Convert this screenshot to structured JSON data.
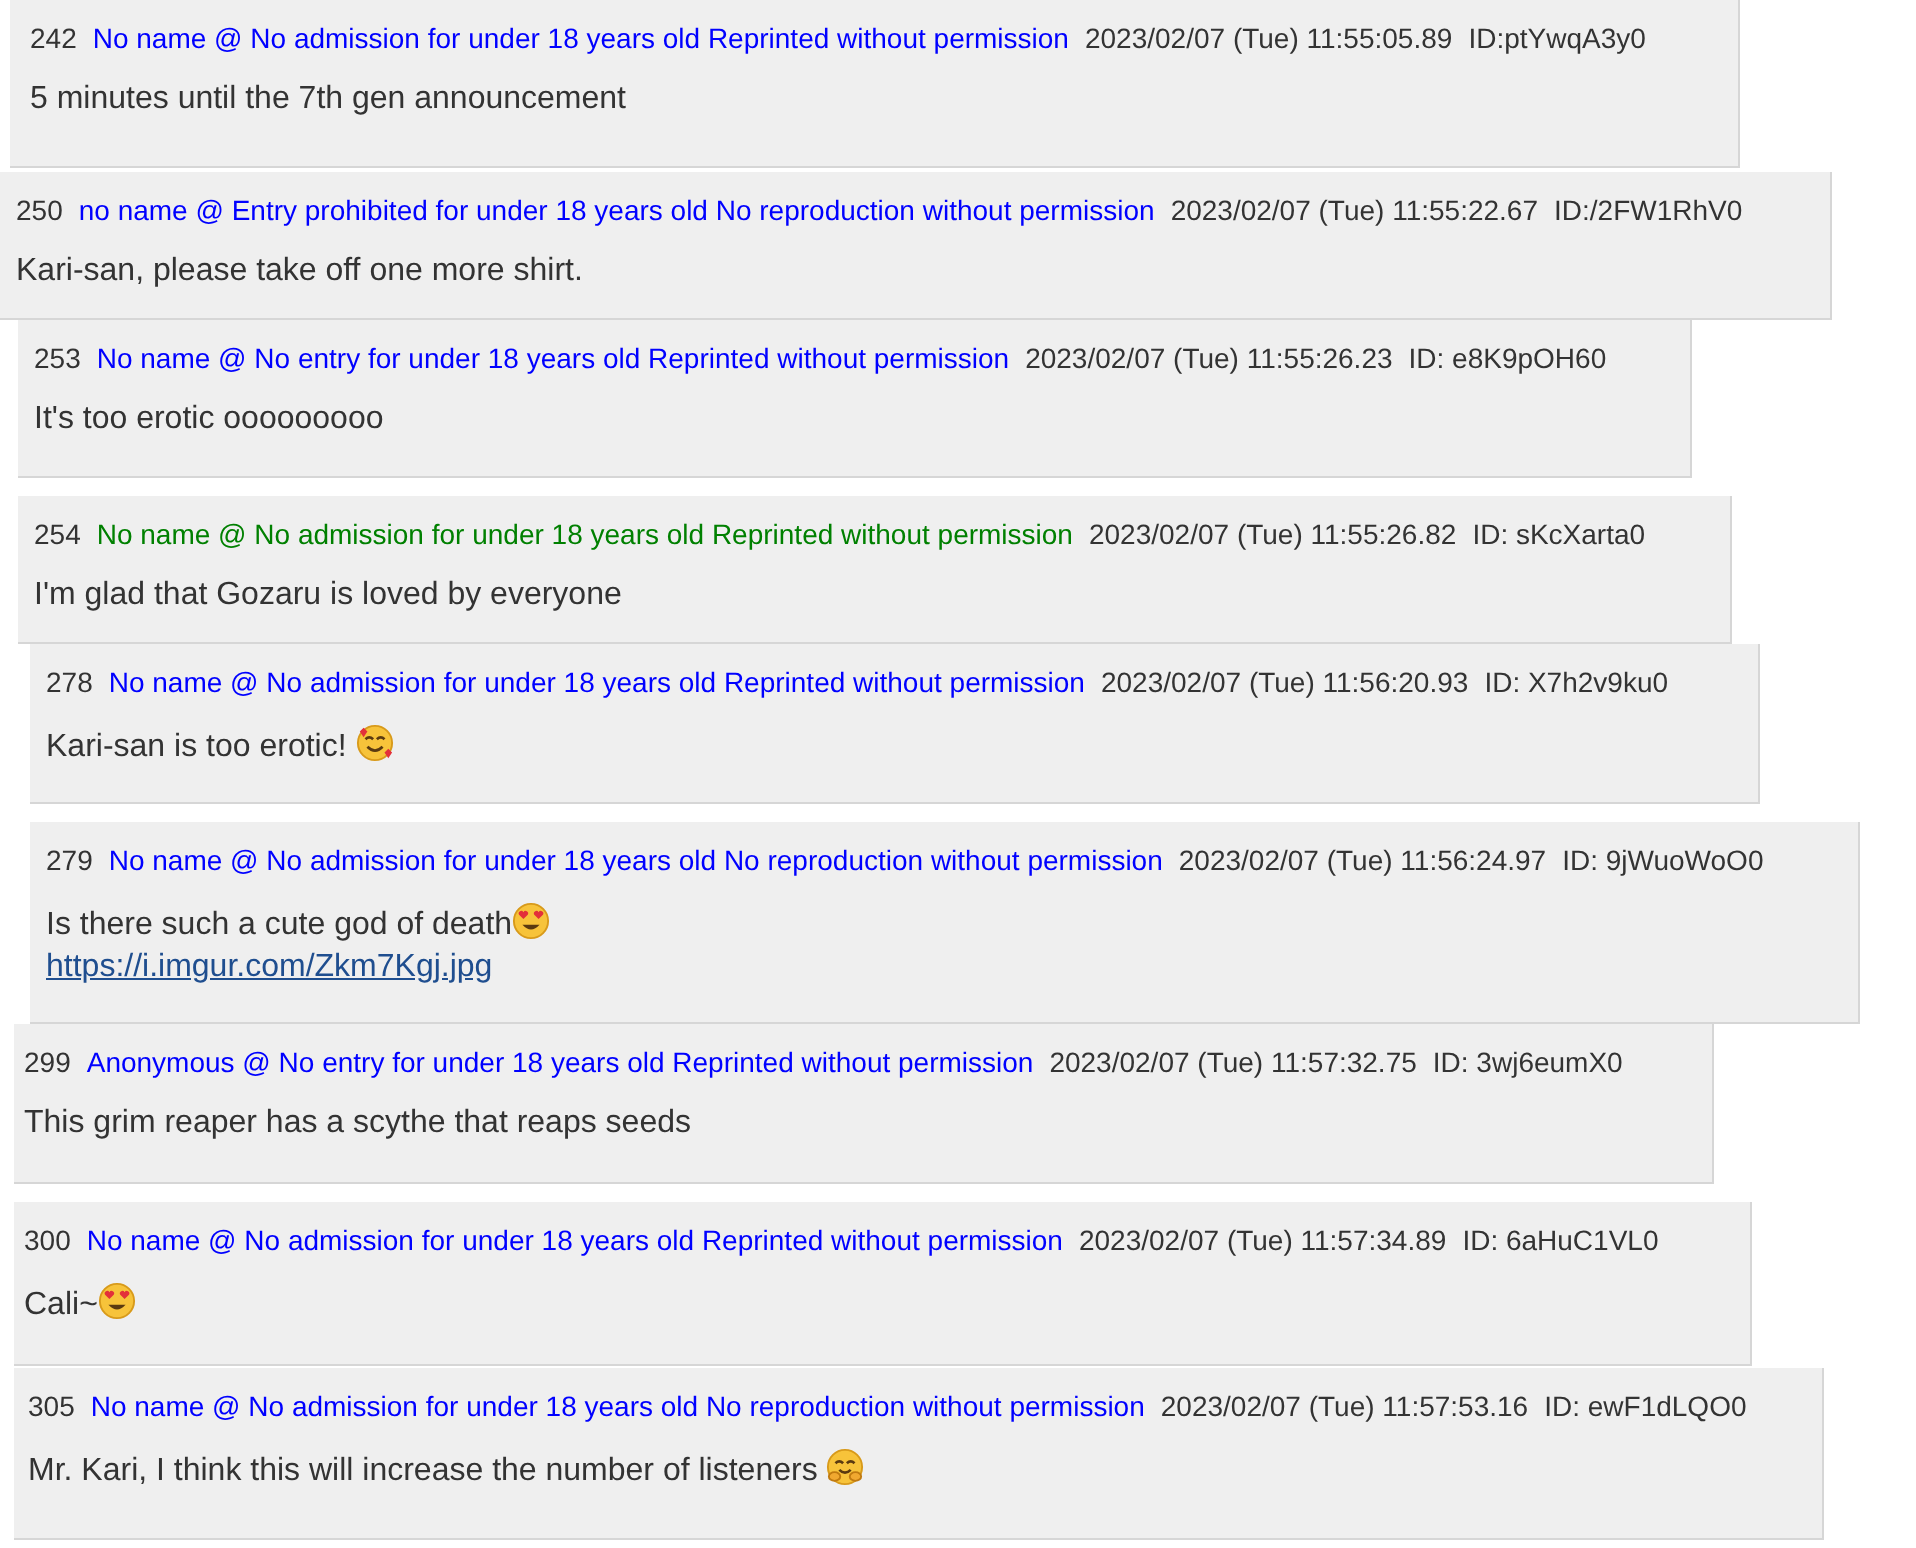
{
  "posts": [
    {
      "number": "242",
      "name": "No name @ No admission for under 18 years old Reprinted without permission",
      "color": "#0000ff",
      "date": "2023/02/07 (Tue) 11:55:05.89",
      "id": "ID:ptYwqA3y0",
      "message": "5 minutes until the 7th gen announcement"
    },
    {
      "number": "250",
      "name": "no name @ Entry prohibited for under 18 years old No reproduction without permission",
      "color": "#0000ff",
      "date": "2023/02/07 (Tue) 11:55:22.67",
      "id": "ID:/2FW1RhV0",
      "message": "Kari-san, please take off one more shirt."
    },
    {
      "number": "253",
      "name": "No name @ No entry for under 18 years old Reprinted without permission",
      "color": "#0000ff",
      "date": "2023/02/07 (Tue) 11:55:26.23",
      "id": "ID: e8K9pOH60",
      "message": "It's too erotic ooooooooo"
    },
    {
      "number": "254",
      "name": "No name @ No admission for under 18 years old Reprinted without permission",
      "color": "#008000",
      "date": "2023/02/07 (Tue) 11:55:26.82",
      "id": "ID: sKcXarta0",
      "message": "I'm glad that Gozaru is loved by everyone"
    },
    {
      "number": "278",
      "name": "No name @ No admission for under 18 years old Reprinted without permission",
      "color": "#0000ff",
      "date": "2023/02/07 (Tue) 11:56:20.93",
      "id": "ID: X7h2v9ku0",
      "message": "Kari-san is too erotic! ",
      "emoji": {
        "kind": "smiling-hearts"
      }
    },
    {
      "number": "279",
      "name": "No name @ No admission for under 18 years old No reproduction without permission",
      "color": "#0000ff",
      "date": "2023/02/07 (Tue) 11:56:24.97",
      "id": "ID: 9jWuoWoO0",
      "message": "Is there such a cute god of death",
      "emoji": {
        "kind": "heart-eyes"
      },
      "link": "https://i.imgur.com/Zkm7Kgj.jpg"
    },
    {
      "number": "299",
      "name": "Anonymous @ No entry for under 18 years old Reprinted without permission",
      "color": "#0000ff",
      "date": "2023/02/07 (Tue) 11:57:32.75",
      "id": "ID: 3wj6eumX0",
      "message": "This grim reaper has a scythe that reaps seeds"
    },
    {
      "number": "300",
      "name": "No name @ No admission for under 18 years old Reprinted without permission",
      "color": "#0000ff",
      "date": "2023/02/07 (Tue) 11:57:34.89",
      "id": "ID: 6aHuC1VL0",
      "message": "Cali~",
      "emoji": {
        "kind": "heart-eyes"
      }
    },
    {
      "number": "305",
      "name": "No name @ No admission for under 18 years old No reproduction without permission",
      "color": "#0000ff",
      "date": "2023/02/07 (Tue) 11:57:53.16",
      "id": "ID: ewF1dLQO0",
      "message": "Mr. Kari, I think this will increase the number of listeners ",
      "emoji": {
        "kind": "hug"
      }
    }
  ]
}
